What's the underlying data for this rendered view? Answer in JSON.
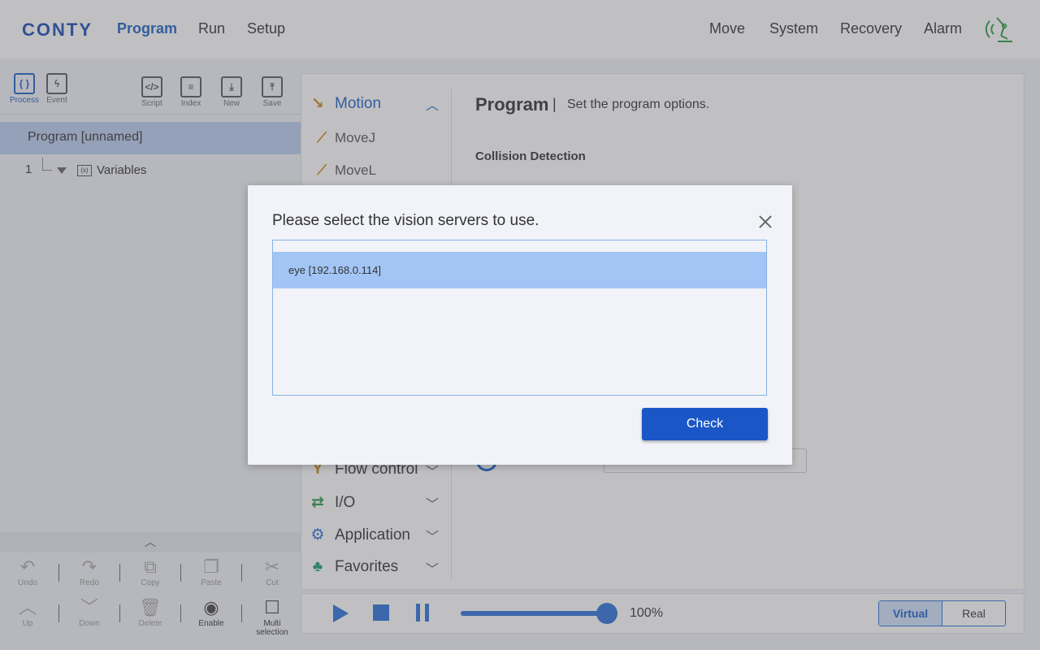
{
  "header": {
    "logo": "CONTY",
    "left_nav": [
      {
        "label": "Program",
        "active": true
      },
      {
        "label": "Run",
        "active": false
      },
      {
        "label": "Setup",
        "active": false
      }
    ],
    "right_nav": [
      {
        "label": "Move"
      },
      {
        "label": "System"
      },
      {
        "label": "Recovery"
      },
      {
        "label": "Alarm"
      }
    ],
    "status_icon": "robot-signal-icon"
  },
  "left_panel": {
    "tools": [
      {
        "label": "Process",
        "glyph": "{ }",
        "active": true
      },
      {
        "label": "Event",
        "glyph": "ϟ",
        "active": false
      },
      {
        "label": "Script",
        "glyph": "</>",
        "active": false
      },
      {
        "label": "Index",
        "glyph": "≡",
        "active": false
      },
      {
        "label": "New",
        "glyph": "⤓",
        "active": false
      },
      {
        "label": "Save",
        "glyph": "⤒",
        "active": false
      }
    ],
    "tree": {
      "root": "Program [unnamed]",
      "line_number": "1",
      "node_icon_text": "(x)",
      "node": "Variables"
    },
    "collapse_glyph": "︿",
    "edit_tools_row1": [
      {
        "label": "Undo",
        "glyph": "↶",
        "enabled": false
      },
      {
        "label": "Redo",
        "glyph": "↷",
        "enabled": false
      },
      {
        "label": "Copy",
        "glyph": "⧉",
        "enabled": false
      },
      {
        "label": "Paste",
        "glyph": "❐",
        "enabled": false
      },
      {
        "label": "Cut",
        "glyph": "✂",
        "enabled": false
      }
    ],
    "edit_tools_row2": [
      {
        "label": "Up",
        "glyph": "︿",
        "enabled": false
      },
      {
        "label": "Down",
        "glyph": "﹀",
        "enabled": false
      },
      {
        "label": "Delete",
        "glyph": "🗑",
        "enabled": false
      },
      {
        "label": "Enable",
        "glyph": "◉",
        "enabled": true
      },
      {
        "label": "Multi selection",
        "glyph": "☐",
        "enabled": true
      }
    ]
  },
  "categories": {
    "motion": {
      "label": "Motion",
      "icon": "↘",
      "chevron": "︿"
    },
    "motion_items": [
      {
        "label": "MoveJ",
        "icon": "⟋"
      },
      {
        "label": "MoveL",
        "icon": "⟋"
      }
    ],
    "others": [
      {
        "label": "Flow control",
        "icon": "Y",
        "chevron": "﹀",
        "color": "#c88a1a"
      },
      {
        "label": "I/O",
        "icon": "⇄",
        "chevron": "﹀",
        "color": "#2a9a4a"
      },
      {
        "label": "Application",
        "icon": "⚙",
        "chevron": "﹀",
        "color": "#2a70d8"
      },
      {
        "label": "Favorites",
        "icon": "♣",
        "chevron": "﹀",
        "color": "#1a9a7a"
      }
    ]
  },
  "main": {
    "title": "Program",
    "separator": "|",
    "description": "Set the program options.",
    "section_label": "Collision Detection"
  },
  "playback": {
    "speed": "100%",
    "speed_fraction": 1.0,
    "modes": [
      {
        "label": "Virtual",
        "active": true
      },
      {
        "label": "Real",
        "active": false
      }
    ]
  },
  "dialog": {
    "title": "Please select the vision servers to use.",
    "close_icon": "close-icon",
    "servers": [
      {
        "label": "eye [192.168.0.114]",
        "selected": true
      }
    ],
    "confirm_label": "Check"
  },
  "colors": {
    "accent": "#1a60c8",
    "selected_row": "#a3c5f5",
    "button": "#1a56c5"
  }
}
